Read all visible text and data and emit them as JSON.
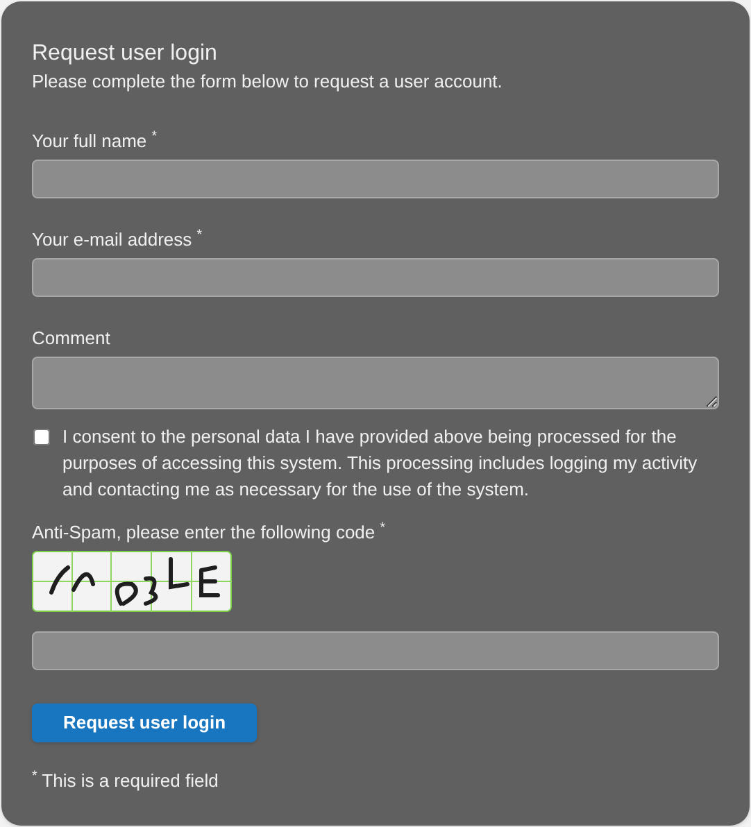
{
  "title": "Request user login",
  "subtitle": "Please complete the form below to request a user account.",
  "fields": [
    {
      "kind": "input",
      "label": "Your full name $^{*}$"
    },
    {
      "kind": "input",
      "label": "Your e-mail address $^{*}$"
    },
    {
      "kind": "textarea",
      "label": "Comment"
    }
  ],
  "consent": {
    "checked": false,
    "text": "I consent to the personal data I have provided above being processed for the purposes of accessing this system. This processing includes logging my activity and contacting me as necessary for the use of the system."
  },
  "captcha": {
    "label": "Anti-Spam, please enter the following code $^{*}$"
  },
  "button": "Request user login",
  "footnote": "$^{*}$ This is a required field"
}
